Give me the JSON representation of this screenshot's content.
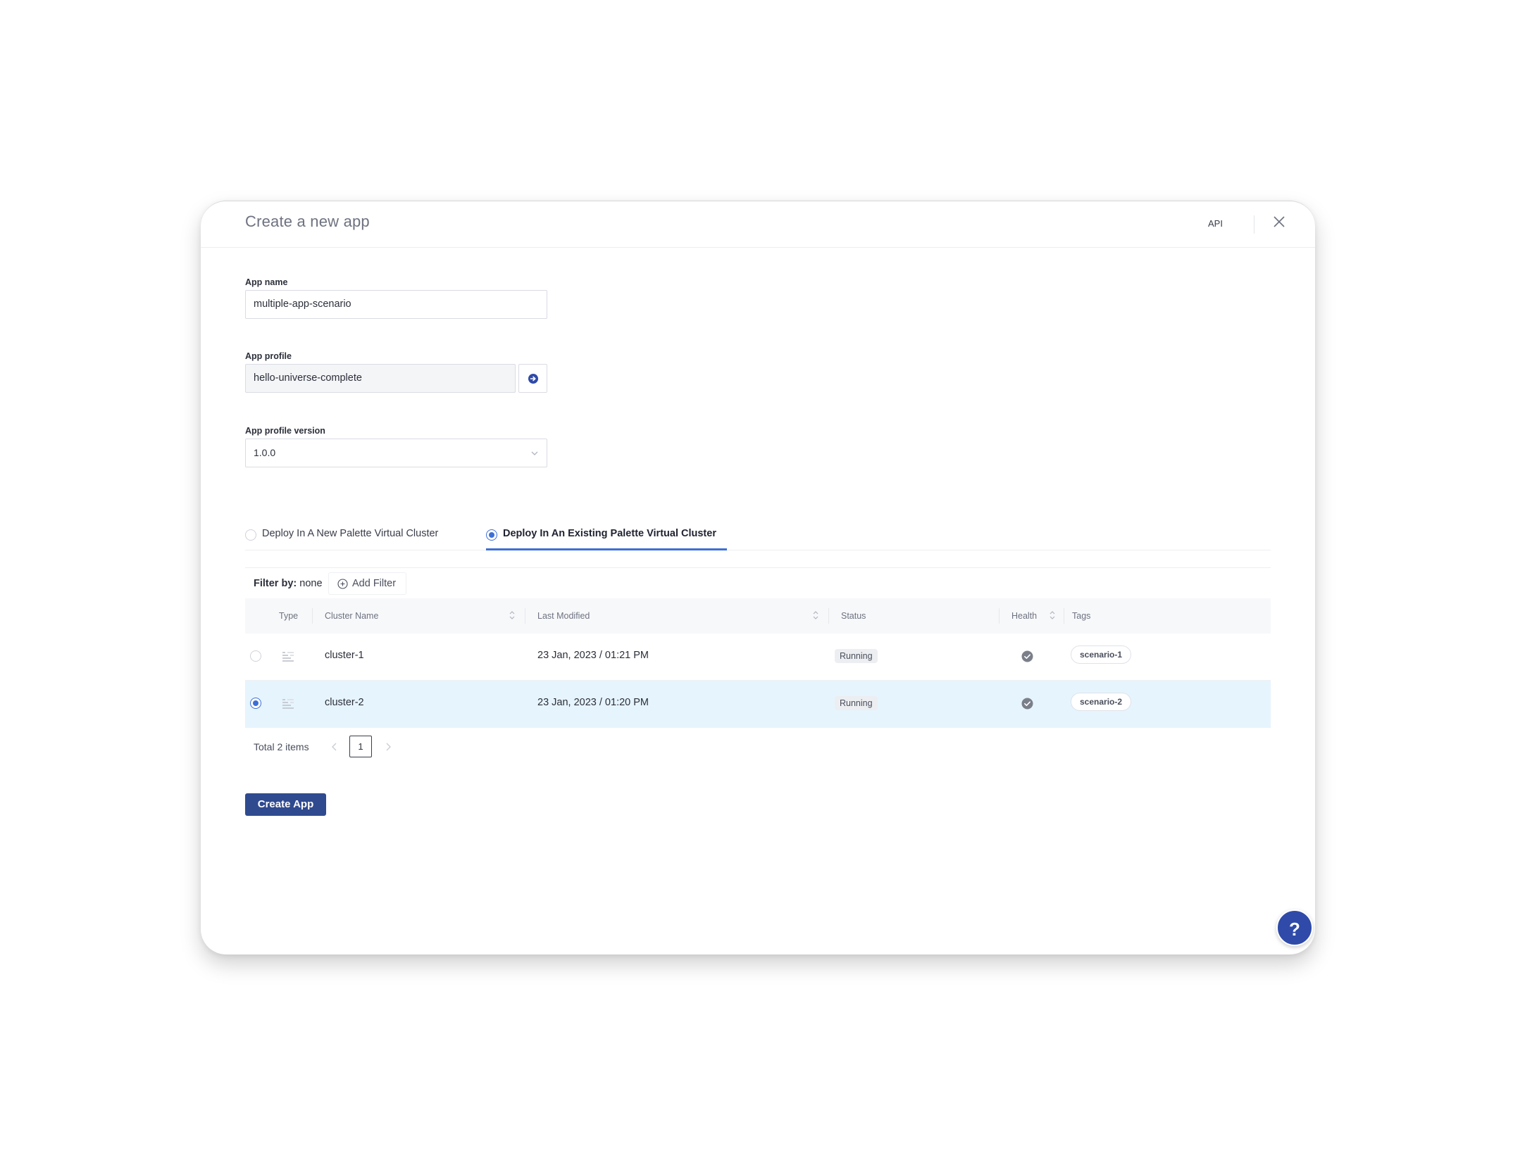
{
  "header": {
    "title": "Create a new app",
    "api_label": "API"
  },
  "form": {
    "app_name": {
      "label": "App name",
      "value": "multiple-app-scenario"
    },
    "app_profile": {
      "label": "App profile",
      "value": "hello-universe-complete"
    },
    "app_profile_version": {
      "label": "App profile version",
      "value": "1.0.0"
    }
  },
  "deploy_options": [
    {
      "label": "Deploy In A New Palette Virtual Cluster",
      "selected": false
    },
    {
      "label": "Deploy In An Existing Palette Virtual Cluster",
      "selected": true
    }
  ],
  "filter": {
    "prefix": "Filter by:",
    "value": "none",
    "add_label": "Add Filter"
  },
  "table": {
    "columns": [
      "Type",
      "Cluster Name",
      "Last Modified",
      "Status",
      "Health",
      "Tags"
    ],
    "rows": [
      {
        "cluster_name": "cluster-1",
        "last_modified": "23 Jan, 2023 / 01:21 PM",
        "status": "Running",
        "health": "healthy",
        "tag": "scenario-1",
        "selected": false
      },
      {
        "cluster_name": "cluster-2",
        "last_modified": "23 Jan, 2023 / 01:20 PM",
        "status": "Running",
        "health": "healthy",
        "tag": "scenario-2",
        "selected": true
      }
    ]
  },
  "pagination": {
    "total_text": "Total 2 items",
    "current_page": "1"
  },
  "actions": {
    "create_label": "Create App"
  },
  "help": {
    "label": "?"
  },
  "colors": {
    "primary": "#2f4a8f",
    "accent": "#3d6fd6",
    "selected_row": "#e6f4fd"
  },
  "icons": [
    "close-icon",
    "arrow-right-circle-icon",
    "chevron-down-icon",
    "plus-circle-icon",
    "sort-icon",
    "cluster-type-icon",
    "check-circle-icon",
    "chevron-left-icon",
    "chevron-right-icon",
    "help-icon"
  ]
}
